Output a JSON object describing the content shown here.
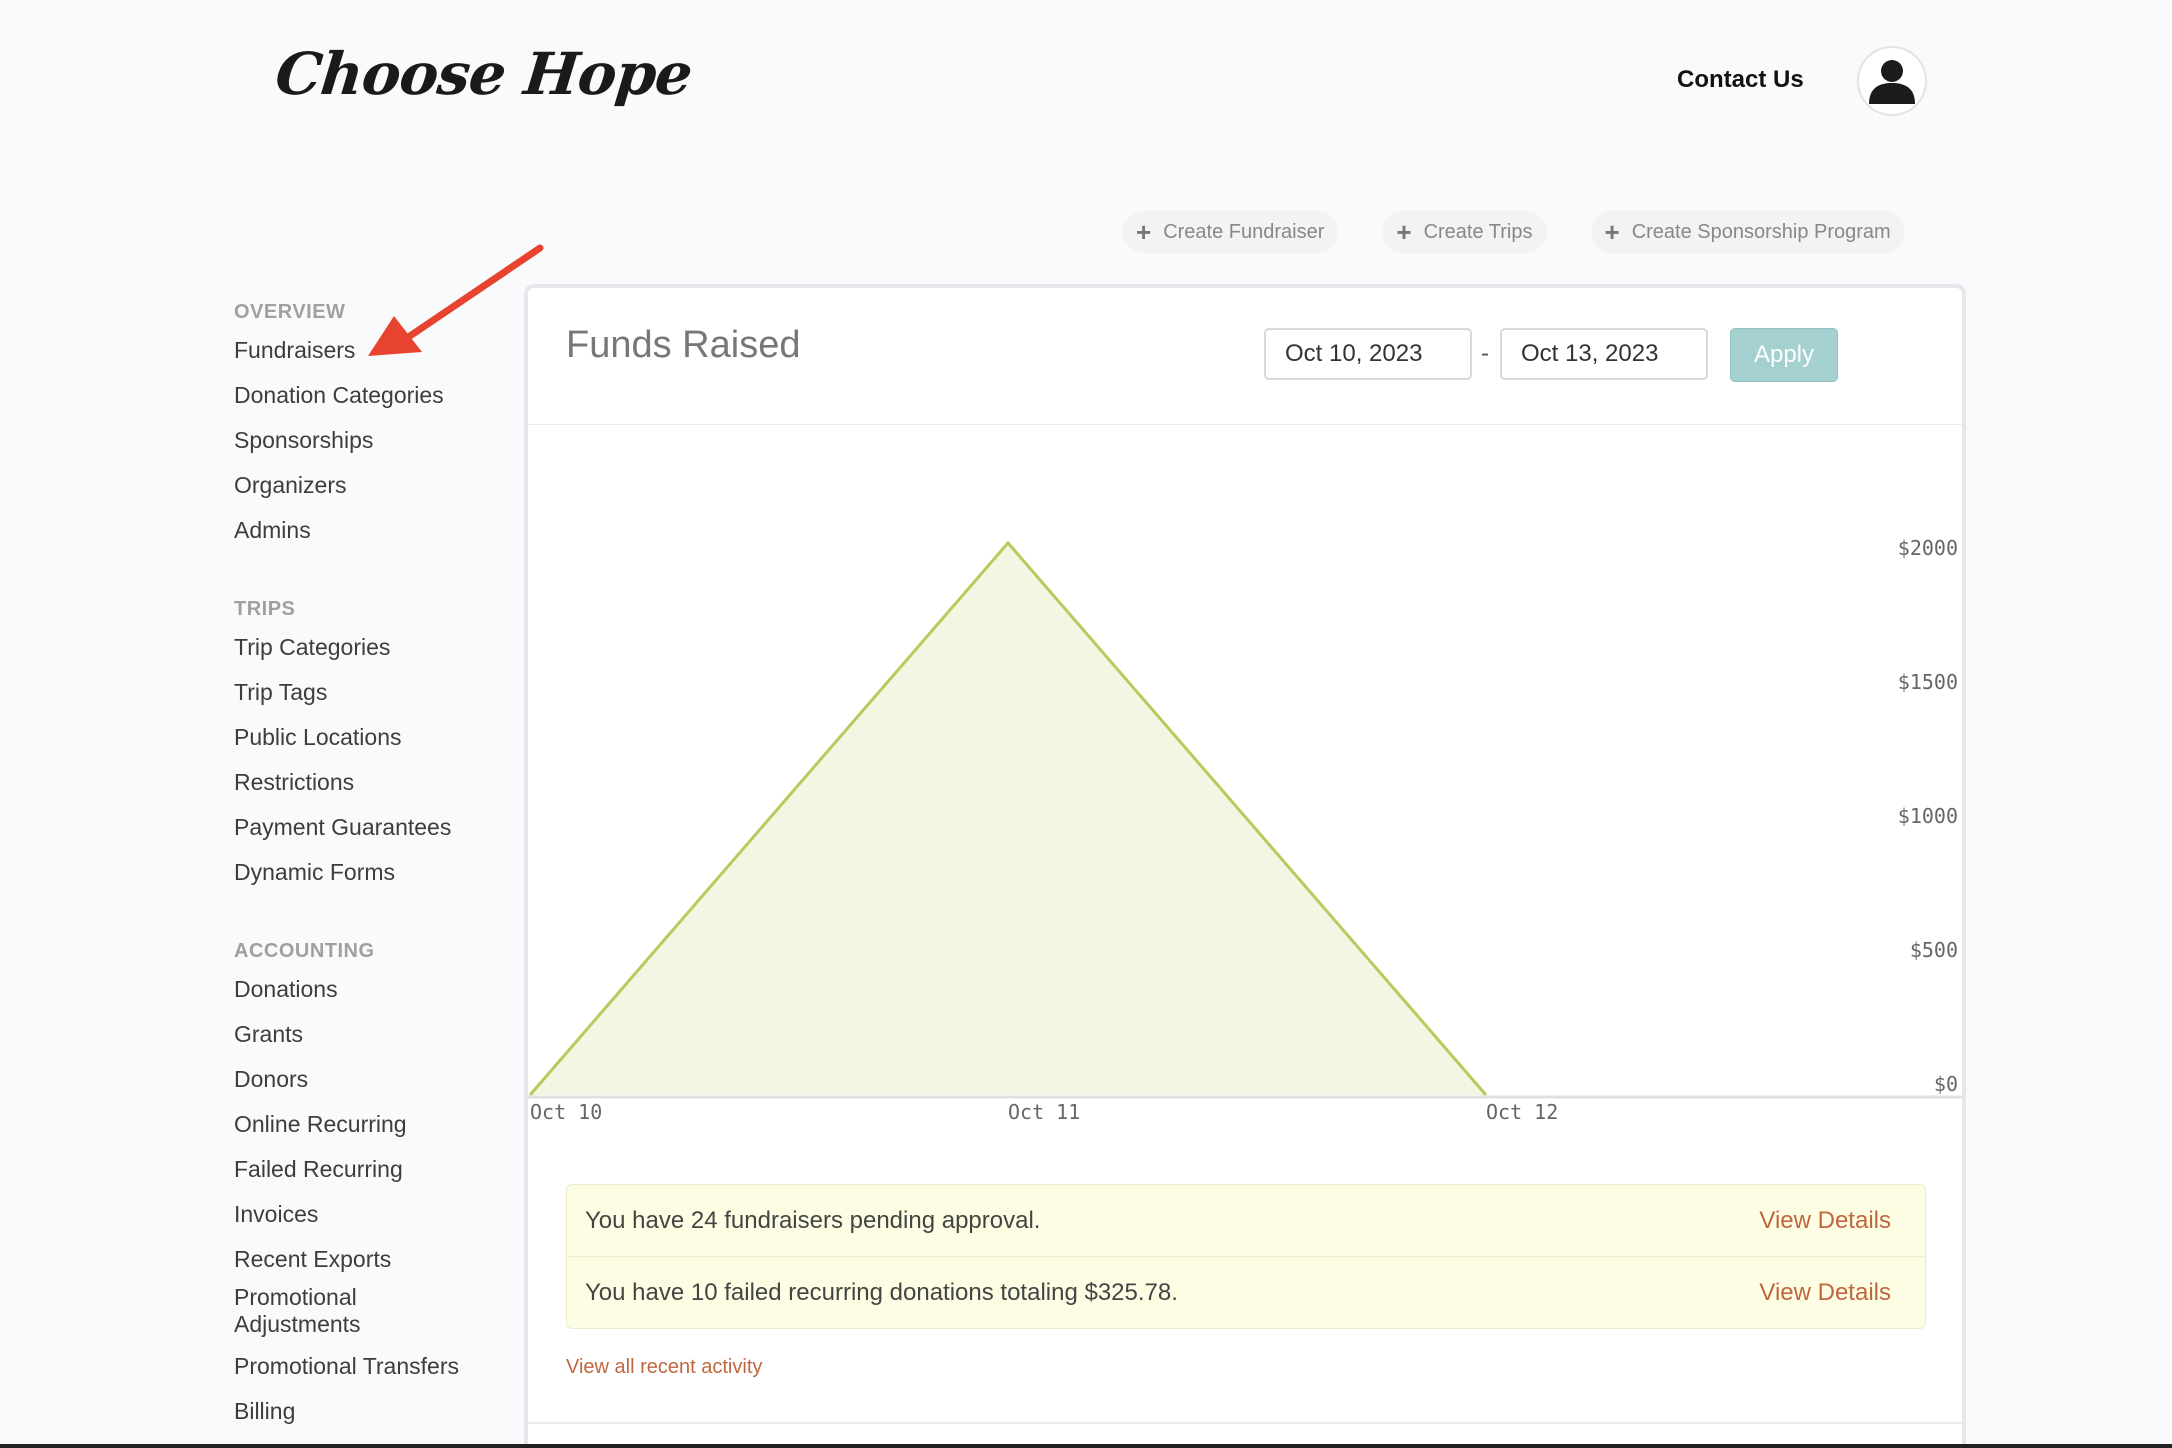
{
  "header": {
    "logo": "Choose Hope",
    "contact_label": "Contact Us",
    "avatar_icon": "user-icon"
  },
  "actions": [
    {
      "icon": "plus-icon",
      "label": "Create Fundraiser"
    },
    {
      "icon": "plus-icon",
      "label": "Create Trips"
    },
    {
      "icon": "plus-icon",
      "label": "Create Sponsorship Program"
    }
  ],
  "sidebar": {
    "overview": {
      "heading": "OVERVIEW",
      "items": [
        "Fundraisers",
        "Donation Categories",
        "Sponsorships",
        "Organizers",
        "Admins"
      ]
    },
    "trips": {
      "heading": "TRIPS",
      "items": [
        "Trip Categories",
        "Trip Tags",
        "Public Locations",
        "Restrictions",
        "Payment Guarantees",
        "Dynamic Forms"
      ]
    },
    "accounting": {
      "heading": "ACCOUNTING",
      "items": [
        "Donations",
        "Grants",
        "Donors",
        "Online Recurring",
        "Failed Recurring",
        "Invoices",
        "Recent Exports",
        "Promotional Adjustments",
        "Promotional Transfers",
        "Billing"
      ]
    }
  },
  "panel": {
    "title": "Funds Raised",
    "date_from": "Oct 10, 2023",
    "date_separator": "-",
    "date_to": "Oct 13, 2023",
    "apply_label": "Apply"
  },
  "chart_data": {
    "type": "area",
    "x": [
      "Oct 10",
      "Oct 11",
      "Oct 12"
    ],
    "values": [
      0,
      2060,
      0
    ],
    "y_ticks": [
      "$0",
      "$500",
      "$1000",
      "$1500",
      "$2000"
    ],
    "y_tick_values": [
      0,
      500,
      1000,
      1500,
      2000
    ],
    "ylim": [
      0,
      2500
    ],
    "y_axis_side": "right",
    "line_color": "#b5cc5c",
    "fill_color": "#f4f5e2"
  },
  "alerts": [
    {
      "text": "You have 24 fundraisers pending approval.",
      "link": "View Details"
    },
    {
      "text": "You have 10 failed recurring donations totaling $325.78.",
      "link": "View Details"
    }
  ],
  "recent_activity_link": "View all recent activity",
  "colors": {
    "accent_link": "#c0663f",
    "apply_button": "#a5d0d0",
    "alert_bg": "#fdfde3",
    "annotation_arrow": "#e8432e"
  }
}
